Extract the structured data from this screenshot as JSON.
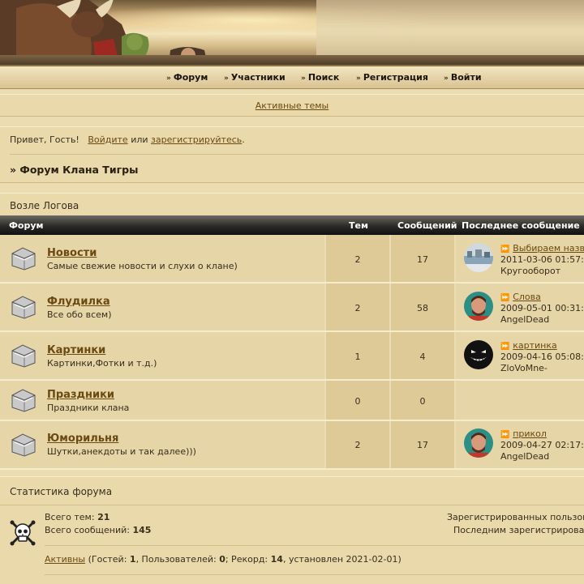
{
  "nav": {
    "items": [
      {
        "label": "Форум"
      },
      {
        "label": "Участники"
      },
      {
        "label": "Поиск"
      },
      {
        "label": "Регистрация"
      },
      {
        "label": "Войти"
      }
    ]
  },
  "active_topics": "Активные темы",
  "welcome": {
    "greeting": "Привет, Гость!",
    "login": "Войдите",
    "or": "или",
    "register": "зарегистрируйтесь",
    "dot": "."
  },
  "breadcrumb": "» Форум Клана Тигры",
  "section": {
    "title": "Возле Логова"
  },
  "table": {
    "headers": {
      "forum": "Форум",
      "topics": "Тем",
      "posts": "Сообщений",
      "last": "Последнее сообщение"
    },
    "rows": [
      {
        "name": "Новости",
        "desc": "Самые свежие новости и слухи о клане)",
        "topics": "2",
        "posts": "17",
        "last_title": "Выбираем назв",
        "last_date": "2011-03-06 01:57:",
        "last_author": "Кругооборот"
      },
      {
        "name": "Флудилка",
        "desc": "Все обо всем)",
        "topics": "2",
        "posts": "58",
        "last_title": "Слова",
        "last_date": "2009-05-01 00:31:",
        "last_author": "AngelDead"
      },
      {
        "name": "Картинки",
        "desc": "Картинки,Фотки и т.д.)",
        "topics": "1",
        "posts": "4",
        "last_title": "картинка",
        "last_date": "2009-04-16 05:08:",
        "last_author": "ZloVoMne-"
      },
      {
        "name": "Праздники",
        "desc": "Праздники клана",
        "topics": "0",
        "posts": "0",
        "last_title": "",
        "last_date": "",
        "last_author": ""
      },
      {
        "name": "Юморильня",
        "desc": "Шутки,анекдоты и так далее)))",
        "topics": "2",
        "posts": "17",
        "last_title": "прикол",
        "last_date": "2009-04-27 02:17:",
        "last_author": "AngelDead"
      }
    ]
  },
  "stats": {
    "title": "Статистика форума",
    "topics_label": "Всего тем:",
    "topics_value": "21",
    "posts_label": "Всего сообщений:",
    "posts_value": "145",
    "registered_label": "Зарегистрированных пользов",
    "last_registered_label": "Последним зарегистрирова",
    "active_link": "Активны",
    "guests_prefix": "(Гостей:",
    "guests_value": "1",
    "users_prefix": ", Пользователей:",
    "users_value": "0",
    "record_prefix": "; Рекорд:",
    "record_value": "14",
    "record_suffix": ", установлен 2021-02-01)"
  },
  "colors": {
    "accent": "#6b4a12",
    "background": "#ebdcb2",
    "header_dark": "#1a1a18"
  }
}
